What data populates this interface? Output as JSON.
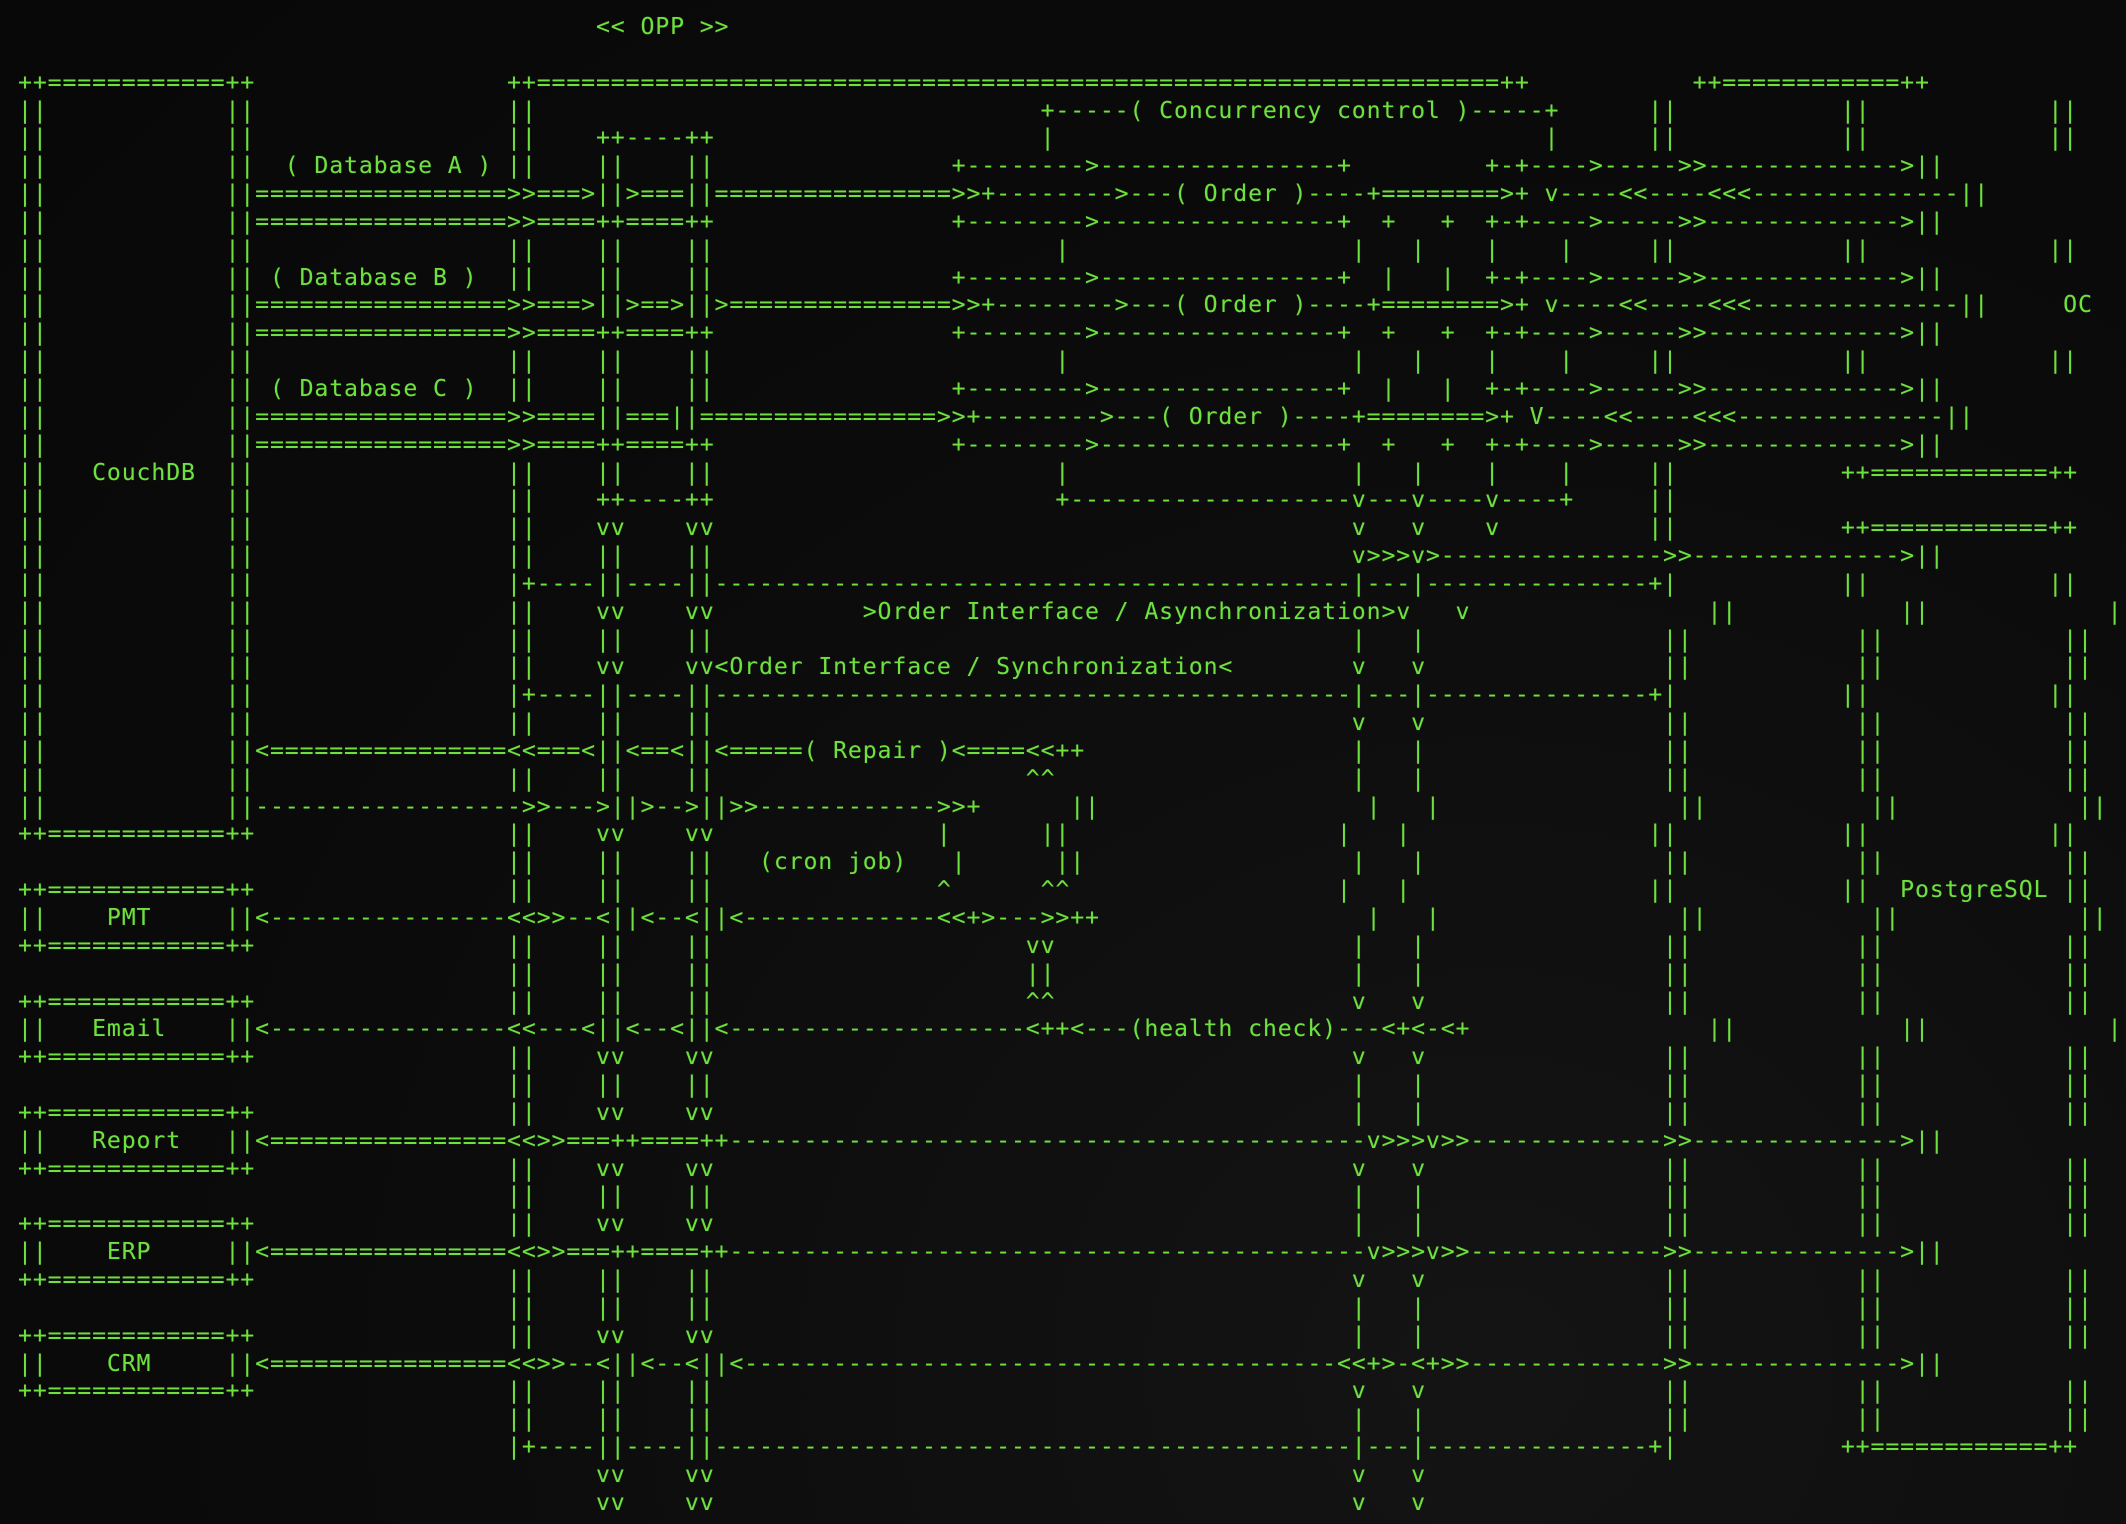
{
  "text_color": "#6ee13f",
  "background_color": "#0b0b0b",
  "lines": [
    "                                       << OPP >>",
    "",
    "++============++                 ++=================================================================++           ++============++",
    "||            ||                 ||                                  +-----( Concurrency control )-----+      ||           ||            ||",
    "||            ||                 ||    ++----++                      |                                 |      ||           ||            ||",
    "||            ||  ( Database A ) ||    ||    ||                +-------->----------------+         +-+---->----->>------------->||            ||",
    "||            ||=================>>===>||>===||================>>+-------->---( Order )----+========>+ v----<<----<<<--------------||            ||",
    "||            ||=================>>====++====++                +-------->----------------+  +   +  +-+---->----->>------------->||            ||",
    "||            ||                 ||    ||    ||                       |                   |   |    |    |     ||           ||            ||",
    "||            || ( Database B )  ||    ||    ||                +-------->----------------+  |   |  +-+---->----->>------------->||            ||",
    "||            ||=================>>===>||>==>||>===============>>+-------->---( Order )----+========>+ v----<<----<<<--------------||     OC     ||",
    "||            ||=================>>====++====++                +-------->----------------+  +   +  +-+---->----->>------------->||            ||",
    "||            ||                 ||    ||    ||                       |                   |   |    |    |     ||           ||            ||",
    "||            || ( Database C )  ||    ||    ||                +-------->----------------+  |   |  +-+---->----->>------------->||            ||",
    "||            ||=================>>====||===||================>>+-------->---( Order )----+========>+ V----<<----<<<--------------||            ||",
    "||            ||=================>>====++====++                +-------->----------------+  +   +  +-+---->----->>------------->||            ||",
    "||   CouchDB  ||                 ||    ||    ||                       |                   |   |    |    |     ||           ++============++",
    "||            ||                 ||    ++----++                       +-------------------v---v----v----+     ||",
    "||            ||                 ||    vv    vv                                           v   v    v          ||           ++============++",
    "||            ||                 ||    ||    ||                                           v>>>v>--------------->>-------------->||            ||",
    "||            ||                 |+----||----||-------------------------------------------|---|---------------+|           ||            ||",
    "||            ||                 ||    vv    vv          >Order Interface / Asynchronization>v   v                ||           ||            ||",
    "||            ||                 ||    ||    ||                                           |   |                ||           ||            ||",
    "||            ||                 ||    vv    vv<Order Interface / Synchronization<        v   v                ||           ||            ||",
    "||            ||                 |+----||----||-------------------------------------------|---|---------------+|           ||            ||",
    "||            ||                 ||    ||    ||                                           v   v                ||           ||            ||",
    "||            ||<================<<===<||<==<||<=====( Repair )<====<<++                  |   |                ||           ||            ||",
    "||            ||                 ||    ||    ||                     ^^                    |   |                ||           ||            ||",
    "||            ||------------------>>--->||>-->||>>------------>>+      ||                  |   |                ||           ||            ||",
    "++============++                 ||    vv    vv               |      ||                  |   |                ||           ||            ||",
    "                                 ||    ||    ||   (cron job)   |      ||                  |   |                ||           ||            ||",
    "++============++                 ||    ||    ||               ^      ^^                  |   |                ||           ||  PostgreSQL ||",
    "||    PMT     ||<----------------<<>>--<||<--<||<-------------<<+>--->>++                  |   |                ||           ||            ||",
    "++============++                 ||    ||    ||                     vv                    |   |                ||           ||            ||",
    "                                 ||    ||    ||                     ||                    |   |                ||           ||            ||",
    "++============++                 ||    ||    ||                     ^^                    v   v                ||           ||            ||",
    "||   Email    ||<----------------<<---<||<--<||<--------------------<++<---(health check)---<+<-<+                ||           ||            ||",
    "++============++                 ||    vv    vv                                           v   v                ||           ||            ||",
    "                                 ||    ||    ||                                           |   |                ||           ||            ||",
    "++============++                 ||    vv    vv                                           |   |                ||           ||            ||",
    "||   Report   ||<================<<>>===++====++-------------------------------------------v>>>v>>------------->>-------------->||            ||",
    "++============++                 ||    vv    vv                                           v   v                ||           ||            ||",
    "                                 ||    ||    ||                                           |   |                ||           ||            ||",
    "++============++                 ||    vv    vv                                           |   |                ||           ||            ||",
    "||    ERP     ||<================<<>>===++====++-------------------------------------------v>>>v>>------------->>-------------->||            ||",
    "++============++                 ||    ||    ||                                           v   v                ||           ||            ||",
    "                                 ||    ||    ||                                           |   |                ||           ||            ||",
    "++============++                 ||    vv    vv                                           |   |                ||           ||            ||",
    "||    CRM     ||<================<<>>--<||<--<||<----------------------------------------<<+>-<+>>------------->>-------------->||            ||",
    "++============++                 ||    ||    ||                                           v   v                ||           ||            ||",
    "                                 ||    ||    ||                                           |   |                ||           ||            ||",
    "                                 |+----||----||-------------------------------------------|---|---------------+|           ++============++",
    "                                       vv    vv                                           v   v",
    "                                       vv    vv                                           v   v"
  ]
}
